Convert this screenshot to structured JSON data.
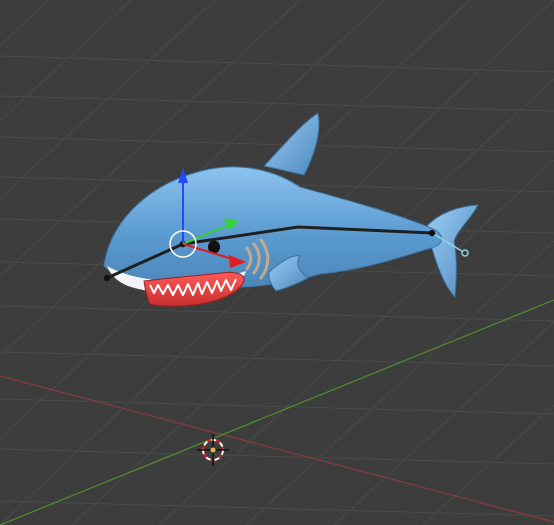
{
  "app": {
    "type": "3D viewport",
    "view": "perspective"
  },
  "viewport": {
    "background_color": "#3d3d3d",
    "grid_color": "#4a4a4a",
    "x_axis_color": "#8b3a3a",
    "y_axis_color": "#4f8f2f"
  },
  "scene": {
    "object": "shark",
    "body_color": "#5b9bd0",
    "belly_color": "#f2f4f7",
    "mouth_color": "#d93a3a",
    "armature_color": "#1f1f1f",
    "selected_bone_color": "#8ad8d8"
  },
  "gizmo": {
    "x_color": "#e21b1b",
    "y_color": "#32d332",
    "z_color": "#2448ff"
  },
  "icons": {
    "cursor": "3d-cursor-icon",
    "speaker": "speaker-icon",
    "rotate": "rotate-gizmo-icon"
  }
}
